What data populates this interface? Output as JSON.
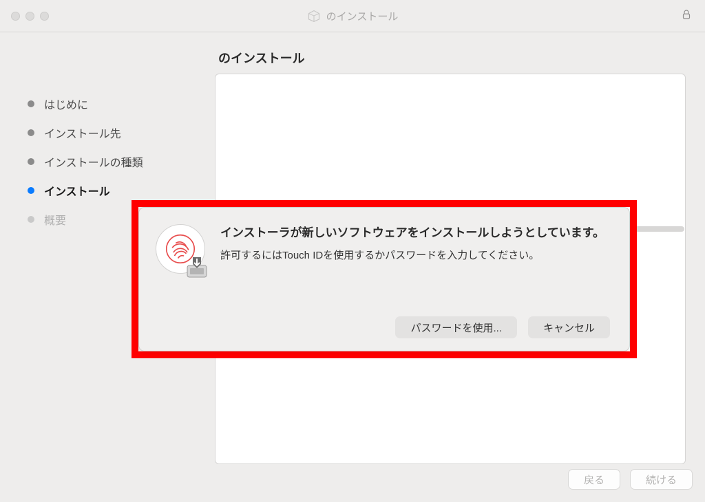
{
  "window": {
    "title": "のインストール"
  },
  "header": {
    "page_title": "のインストール"
  },
  "sidebar": {
    "items": [
      {
        "label": "はじめに",
        "state": "done"
      },
      {
        "label": "インストール先",
        "state": "done"
      },
      {
        "label": "インストールの種類",
        "state": "done"
      },
      {
        "label": "インストール",
        "state": "active"
      },
      {
        "label": "概要",
        "state": "pending"
      }
    ]
  },
  "dialog": {
    "heading": "インストーラが新しいソフトウェアをインストールしようとしています。",
    "subtext": "許可するにはTouch IDを使用するかパスワードを入力してください。",
    "use_password_label": "パスワードを使用...",
    "cancel_label": "キャンセル"
  },
  "footer": {
    "back_label": "戻る",
    "continue_label": "続ける"
  }
}
